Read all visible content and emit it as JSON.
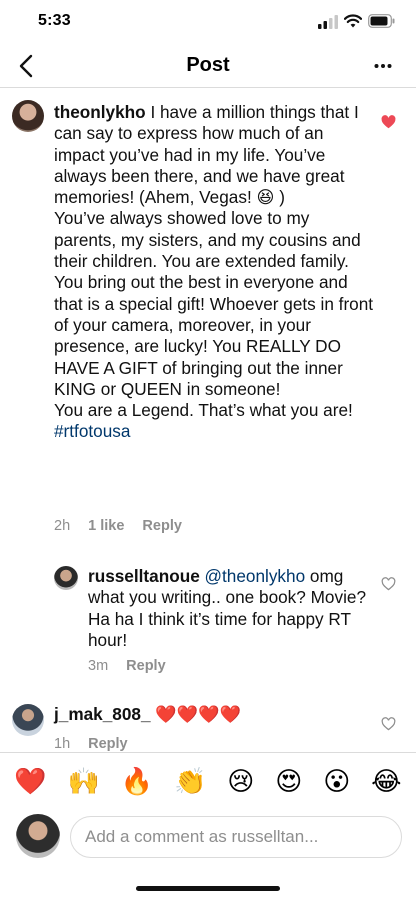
{
  "status_bar": {
    "time": "5:33"
  },
  "header": {
    "title": "Post"
  },
  "comments": [
    {
      "username": "theonlykho",
      "text": " I have a million things that I can say to express how much of an impact you’ve had in my life. You’ve always been there, and we have great memories! (Ahem, Vegas! 😆 )\nYou’ve always showed love to my parents, my sisters, and my cousins and their children. You are extended family.\nYou bring out the best in everyone and that is a special gift! Whoever gets in front of your camera, moreover, in your presence, are lucky! You REALLY DO HAVE A GIFT of bringing out the inner KING or QUEEN in someone!\nYou are a Legend. That’s what you are! ",
      "hashtag": "#rtfotousa",
      "time": "2h",
      "likes": "1 like",
      "reply": "Reply",
      "liked": true
    },
    {
      "username": "russelltanoue",
      "mention": "@theonlykho",
      "text": " omg what you writing.. one book? Movie?  Ha ha I think it’s time for happy RT hour!",
      "time": "3m",
      "reply": "Reply",
      "liked": false
    },
    {
      "username": "j_mak_808_",
      "text": " ❤️❤️❤️❤️",
      "time": "1h",
      "reply": "Reply",
      "liked": false
    }
  ],
  "emoji_bar": [
    "❤️",
    "🙌",
    "🔥",
    "👏",
    "😢",
    "😍",
    "😮",
    "😂"
  ],
  "comment_input": {
    "placeholder": "Add a comment as russelltan..."
  },
  "colors": {
    "like_red": "#ed4956",
    "link_blue": "#00376b",
    "secondary_text": "#8e8e8e",
    "divider": "#dbdbdb"
  }
}
